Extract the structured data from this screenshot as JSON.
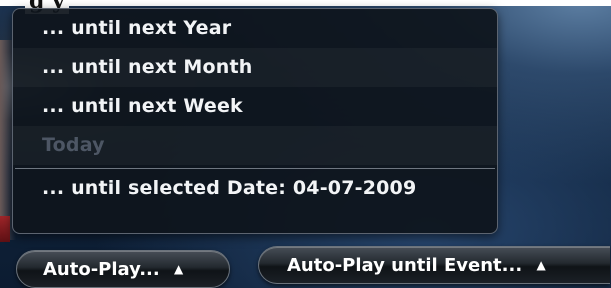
{
  "header": {
    "clipped_title": "g                    y"
  },
  "menu": {
    "items": [
      {
        "label": "... until next Year",
        "enabled": true
      },
      {
        "label": "... until next Month",
        "enabled": true
      },
      {
        "label": "... until next Week",
        "enabled": true
      },
      {
        "label": "Today",
        "enabled": false
      }
    ],
    "selected_date_item": {
      "label": "... until selected Date: 04-07-2009"
    }
  },
  "toolbar": {
    "autoplay_label": "Auto-Play...",
    "autoplay_arrow": "▲",
    "event_label": "Auto-Play until Event...",
    "event_arrow": "▲"
  }
}
